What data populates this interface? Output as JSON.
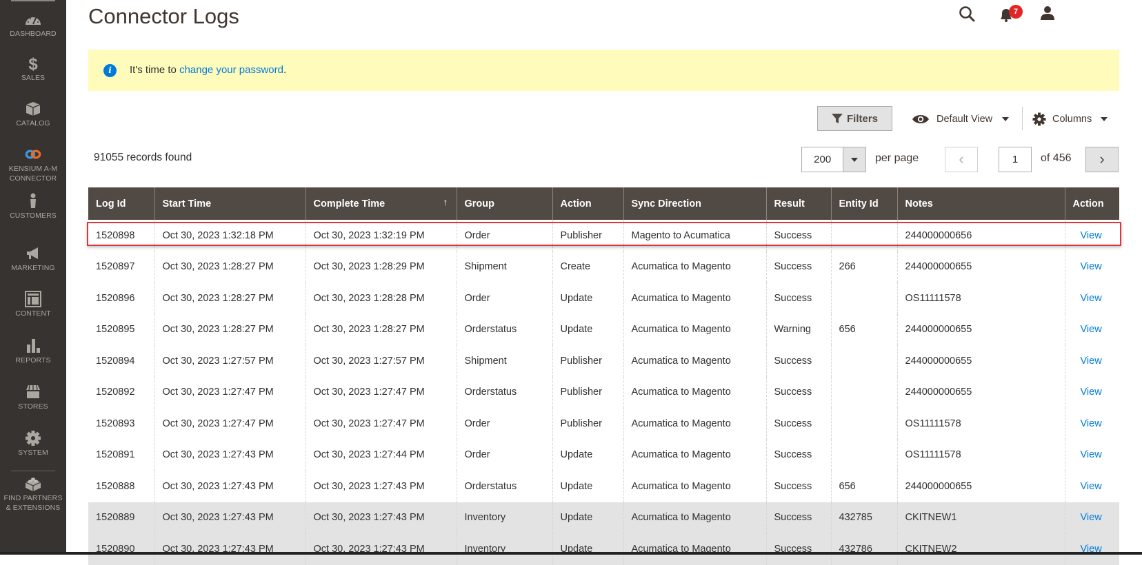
{
  "sidebar": {
    "items": [
      {
        "label": "DASHBOARD",
        "icon": "dashboard-icon"
      },
      {
        "label": "SALES",
        "icon": "dollar-icon"
      },
      {
        "label": "CATALOG",
        "icon": "box-icon"
      },
      {
        "label": "KENSIUM A-M CONNECTOR",
        "label_line1": "KENSIUM A-M",
        "label_line2": "CONNECTOR",
        "icon": "chain-link-icon"
      },
      {
        "label": "CUSTOMERS",
        "icon": "person-icon"
      },
      {
        "label": "MARKETING",
        "icon": "megaphone-icon"
      },
      {
        "label": "CONTENT",
        "icon": "layout-icon"
      },
      {
        "label": "REPORTS",
        "icon": "bar-chart-icon"
      },
      {
        "label": "STORES",
        "icon": "storefront-icon"
      },
      {
        "label": "SYSTEM",
        "icon": "gear-icon"
      },
      {
        "label": "FIND PARTNERS & EXTENSIONS",
        "label_line1": "FIND PARTNERS",
        "label_line2": "& EXTENSIONS",
        "icon": "lego-brick-icon"
      }
    ]
  },
  "header": {
    "title": "Connector Logs",
    "notification_count": "7"
  },
  "notice": {
    "prefix": "It's time to ",
    "link": "change your password",
    "suffix": "."
  },
  "toolbar": {
    "filters_label": "Filters",
    "view_label": "Default View",
    "columns_label": "Columns",
    "records_found": "91055 records found",
    "per_page_value": "200",
    "per_page_label": "per page",
    "page_value": "1",
    "page_of": "of 456"
  },
  "colors": {
    "sidebar_bg": "#373330",
    "header_bg": "#514943",
    "link": "#007bdb",
    "notice_bg": "#fffbbb",
    "badge": "#e22626",
    "highlight": "#e2353a"
  },
  "table": {
    "columns": [
      "Log Id",
      "Start Time",
      "Complete Time",
      "Group",
      "Action",
      "Sync Direction",
      "Result",
      "Entity Id",
      "Notes",
      "Action"
    ],
    "sort_indicator": "↑",
    "rows": [
      [
        "1520898",
        "Oct 30, 2023 1:32:18 PM",
        "Oct 30, 2023 1:32:19 PM",
        "Order",
        "Publisher",
        "Magento to Acumatica",
        "Success",
        "",
        "244000000656",
        "View"
      ],
      [
        "1520897",
        "Oct 30, 2023 1:28:27 PM",
        "Oct 30, 2023 1:28:29 PM",
        "Shipment",
        "Create",
        "Acumatica to Magento",
        "Success",
        "266",
        "244000000655",
        "View"
      ],
      [
        "1520896",
        "Oct 30, 2023 1:28:27 PM",
        "Oct 30, 2023 1:28:28 PM",
        "Order",
        "Update",
        "Acumatica to Magento",
        "Success",
        "",
        "OS11111578",
        "View"
      ],
      [
        "1520895",
        "Oct 30, 2023 1:28:27 PM",
        "Oct 30, 2023 1:28:27 PM",
        "Orderstatus",
        "Update",
        "Acumatica to Magento",
        "Warning",
        "656",
        "244000000655",
        "View"
      ],
      [
        "1520894",
        "Oct 30, 2023 1:27:57 PM",
        "Oct 30, 2023 1:27:57 PM",
        "Shipment",
        "Publisher",
        "Acumatica to Magento",
        "Success",
        "",
        "244000000655",
        "View"
      ],
      [
        "1520892",
        "Oct 30, 2023 1:27:47 PM",
        "Oct 30, 2023 1:27:47 PM",
        "Orderstatus",
        "Publisher",
        "Acumatica to Magento",
        "Success",
        "",
        "244000000655",
        "View"
      ],
      [
        "1520893",
        "Oct 30, 2023 1:27:47 PM",
        "Oct 30, 2023 1:27:47 PM",
        "Order",
        "Publisher",
        "Acumatica to Magento",
        "Success",
        "",
        "OS11111578",
        "View"
      ],
      [
        "1520891",
        "Oct 30, 2023 1:27:43 PM",
        "Oct 30, 2023 1:27:44 PM",
        "Order",
        "Update",
        "Acumatica to Magento",
        "Success",
        "",
        "OS11111578",
        "View"
      ],
      [
        "1520888",
        "Oct 30, 2023 1:27:43 PM",
        "Oct 30, 2023 1:27:43 PM",
        "Orderstatus",
        "Update",
        "Acumatica to Magento",
        "Success",
        "656",
        "244000000655",
        "View"
      ],
      [
        "1520889",
        "Oct 30, 2023 1:27:43 PM",
        "Oct 30, 2023 1:27:43 PM",
        "Inventory",
        "Update",
        "Acumatica to Magento",
        "Success",
        "432785",
        "CKITNEW1",
        "View"
      ],
      [
        "1520890",
        "Oct 30, 2023 1:27:43 PM",
        "Oct 30, 2023 1:27:43 PM",
        "Inventory",
        "Update",
        "Acumatica to Magento",
        "Success",
        "432786",
        "CKITNEW2",
        "View"
      ]
    ]
  }
}
